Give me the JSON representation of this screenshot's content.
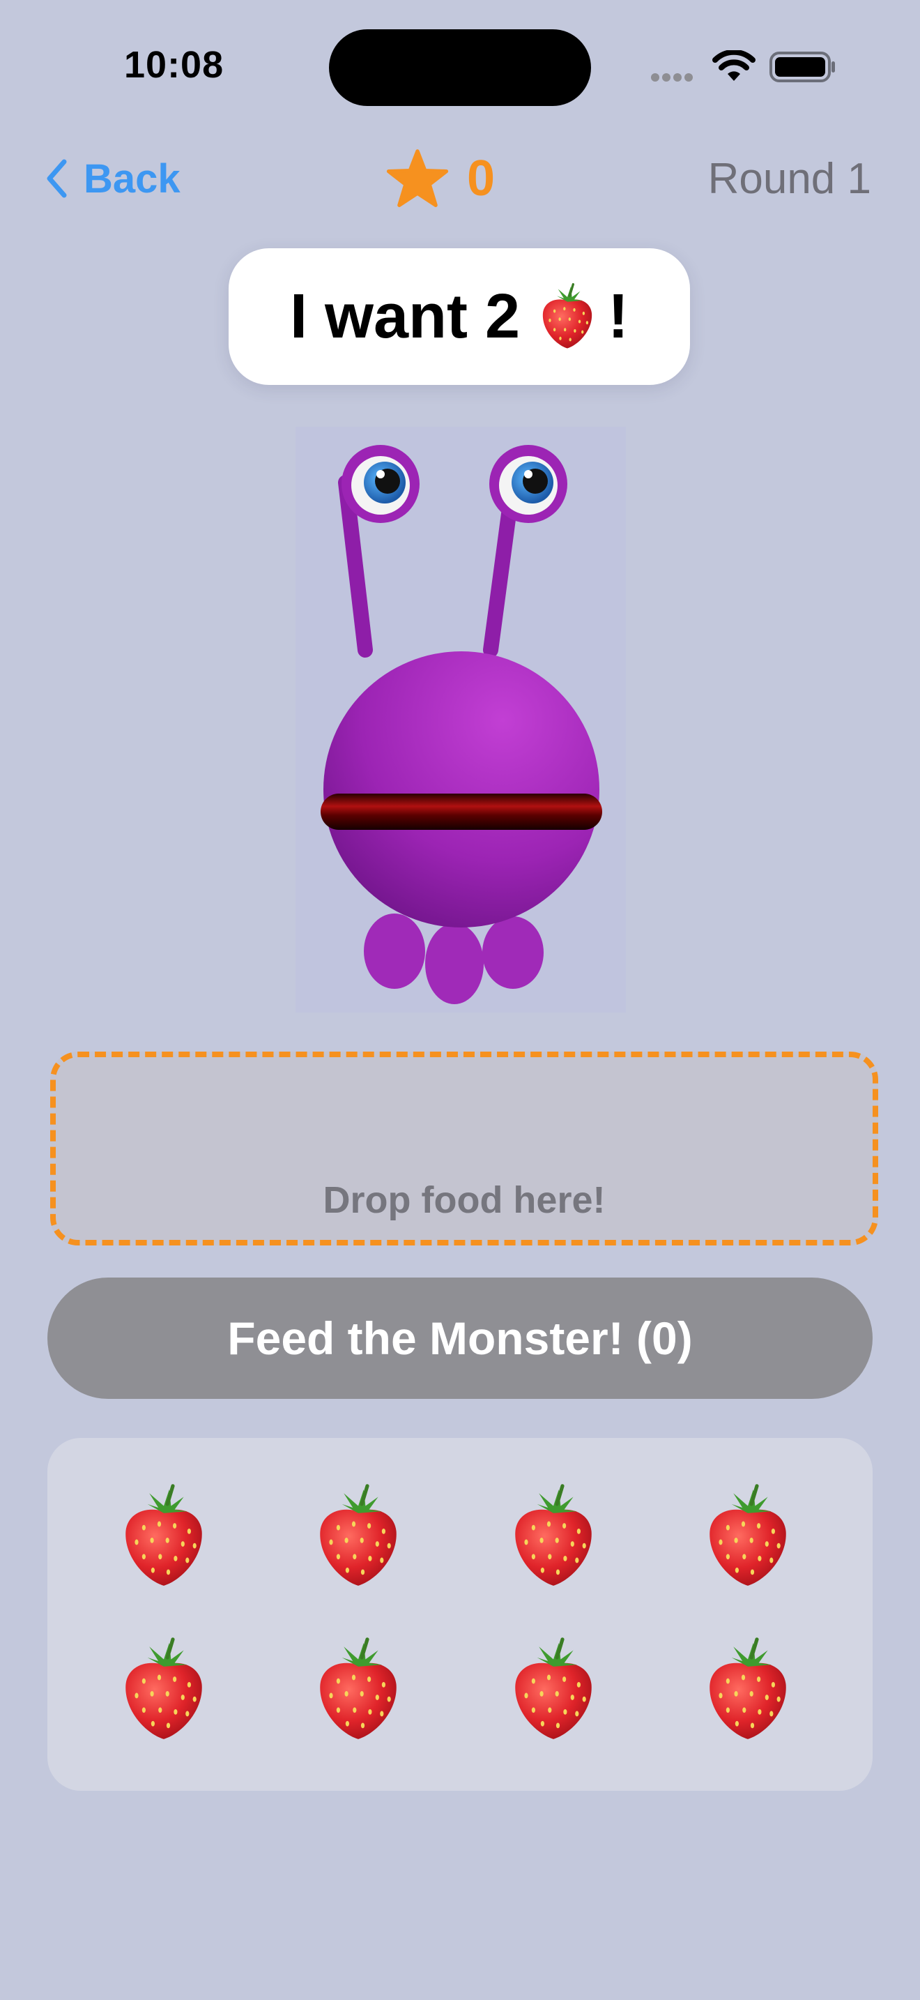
{
  "status_bar": {
    "time": "10:08"
  },
  "nav": {
    "back_label": "Back",
    "score": "0",
    "round_label": "Round 1"
  },
  "bubble": {
    "prefix": "I want 2",
    "suffix": "!"
  },
  "drop_zone": {
    "hint": "Drop food here!"
  },
  "feed_button": {
    "label": "Feed the Monster! (0)"
  },
  "tray": {
    "items": [
      {
        "name": "strawberry-icon"
      },
      {
        "name": "strawberry-icon"
      },
      {
        "name": "strawberry-icon"
      },
      {
        "name": "strawberry-icon"
      },
      {
        "name": "strawberry-icon"
      },
      {
        "name": "strawberry-icon"
      },
      {
        "name": "strawberry-icon"
      },
      {
        "name": "strawberry-icon"
      }
    ]
  },
  "colors": {
    "background": "#c3c8dc",
    "accent_orange": "#f6911f",
    "link_blue": "#3d97f2",
    "monster_purple": "#9c24b4",
    "button_gray": "#8f8f94"
  }
}
